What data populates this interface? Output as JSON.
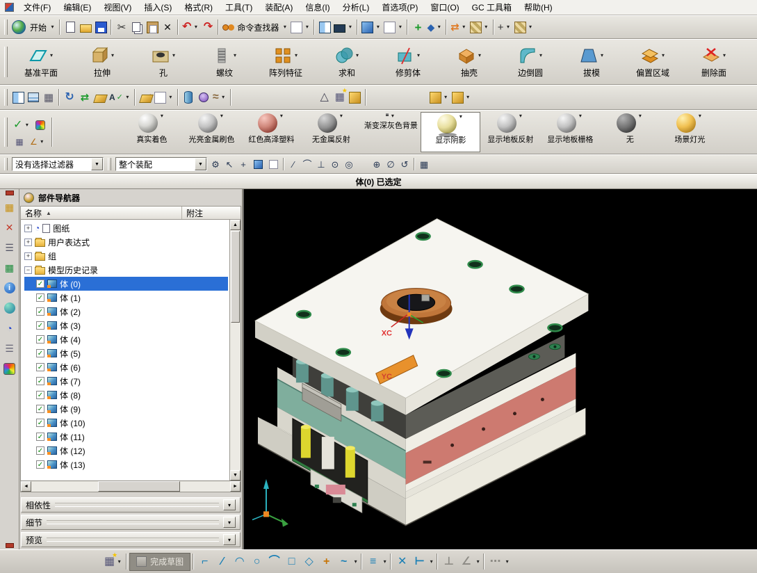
{
  "menu_bar": {
    "items": [
      "文件(F)",
      "编辑(E)",
      "视图(V)",
      "插入(S)",
      "格式(R)",
      "工具(T)",
      "装配(A)",
      "信息(I)",
      "分析(L)",
      "首选项(P)",
      "窗口(O)",
      "GC 工具箱",
      "帮助(H)"
    ]
  },
  "toolbar_main": {
    "start_label": "开始",
    "command_finder_label": "命令查找器"
  },
  "feature_toolbar": {
    "items": [
      "基准平面",
      "拉伸",
      "孔",
      "螺纹",
      "阵列特征",
      "求和",
      "修剪体",
      "抽壳",
      "边倒圆",
      "拔模",
      "偏置区域",
      "删除面"
    ]
  },
  "render_toolbar": {
    "items": [
      "真实着色",
      "光亮金属刷色",
      "红色高泽塑料",
      "无金属反射",
      "渐变深灰色背景",
      "显示阴影",
      "显示地板反射",
      "显示地板栅格",
      "无",
      "场景灯光"
    ],
    "active_item": "显示阴影"
  },
  "selection_bar": {
    "filter_value": "没有选择过滤器",
    "scope_value": "整个装配"
  },
  "status_bar": {
    "message": "体(0) 已选定"
  },
  "navigator": {
    "title": "部件导航器",
    "col_name": "名称",
    "col_note": "附注",
    "items": [
      "图纸",
      "用户表达式",
      "组",
      "模型历史记录"
    ],
    "bodies": [
      "体 (0)",
      "体 (1)",
      "体 (2)",
      "体 (3)",
      "体 (4)",
      "体 (5)",
      "体 (6)",
      "体 (7)",
      "体 (8)",
      "体 (9)",
      "体 (10)",
      "体 (11)",
      "体 (12)",
      "体 (13)"
    ],
    "selected_body": "体 (0)",
    "panels": [
      "相依性",
      "细节",
      "预览"
    ]
  },
  "viewport": {
    "label_xc": "XC",
    "label_yc": "YC"
  },
  "bottom_toolbar": {
    "finish_label": "完成草图"
  },
  "glyphs": {
    "caret": "▾",
    "dd": "▼",
    "sort": "▲",
    "plus": "+",
    "minus": "−",
    "check": "✓",
    "up": "▲",
    "down": "▼",
    "left": "◄",
    "right": "►",
    "cut": "✂",
    "del": "✕",
    "undo": "↶",
    "redo": "↷",
    "gear": "⚙",
    "pointer": "↖",
    "tri": "△",
    "grid": "▦",
    "star": "★",
    "orient": "↻",
    "swap": "⇄",
    "spring": "≈",
    "abc": "A",
    "line": "∕",
    "arc": "◠",
    "arc2": "⌒",
    "circle": "○",
    "rect": "□",
    "poly": "◇",
    "point": "+",
    "profile": "⌐",
    "spline": "~",
    "offset": "≡",
    "angle": "∠",
    "perp": "⊥",
    "extend": "⊢",
    "dots": "⋯",
    "clock": "◔",
    "menu": "☰",
    "info": "i",
    "snap_center": "⊙",
    "snap_circle": "◎",
    "snap_quad": "⊕",
    "snap_null": "∅",
    "snap_rot": "↺",
    "diamond": "◆"
  }
}
